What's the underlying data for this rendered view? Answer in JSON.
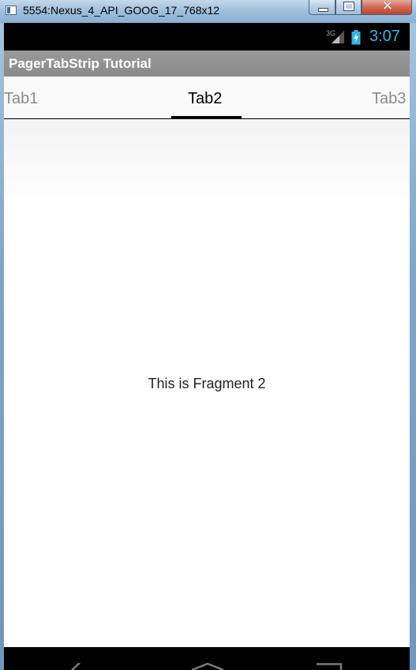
{
  "window": {
    "title": "5554:Nexus_4_API_GOOG_17_768x12",
    "close_glyph": "✕"
  },
  "status_bar": {
    "network_type": "3G",
    "time": "3:07"
  },
  "action_bar": {
    "title": "PagerTabStrip Tutorial"
  },
  "tabs": {
    "previous": "Tab1",
    "current": "Tab2",
    "next": "Tab3"
  },
  "fragment": {
    "text": "This is Fragment 2"
  },
  "colors": {
    "clock": "#33b5e5",
    "action_bar": "#8f8f8f",
    "tab_indicator": "#000000"
  },
  "icons": [
    "app-icon",
    "minimize-icon",
    "maximize-icon",
    "close-icon",
    "signal-icon",
    "battery-charging-icon",
    "back-icon",
    "home-icon",
    "recents-icon"
  ]
}
